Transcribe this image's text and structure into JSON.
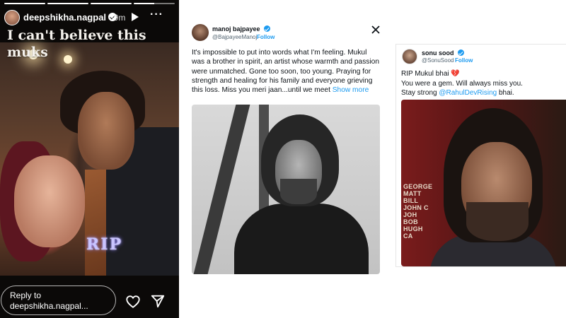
{
  "story": {
    "username": "deepshikha.nagpal",
    "time": "39m",
    "caption_line1": "I can't believe this",
    "caption_line2": "muks",
    "sticker": "RIP",
    "reply_prefix": "Reply to",
    "reply_user": "deepshikha.nagpal...",
    "progress": [
      1,
      1,
      1,
      0.5
    ]
  },
  "tweet1": {
    "name": "manoj bajpayee",
    "handle": "@BajpayeeManoj",
    "separator": " · ",
    "follow": "Follow",
    "text": "It's impossible to put into words what I'm feeling. Mukul was a brother in spirit, an artist whose warmth and passion were unmatched. Gone too soon, too young. Praying for strength and healing for his family and everyone grieving this loss. Miss you meri jaan...until we meet ",
    "show_more": "Show more"
  },
  "tweet2": {
    "name": "sonu sood",
    "handle": "@SonuSood",
    "separator": " · ",
    "follow": "Follow",
    "line1": "RIP Mukul bhai ",
    "broken_heart": "💔",
    "line2": "You were a gem. Will always miss you.",
    "line3_prefix": "Stay strong ",
    "mention": "@RahulDevRising",
    "line3_suffix": " bhai.",
    "wall_text": [
      "GEORGE",
      "MATT",
      "BILL",
      "JOHN C",
      "JOH",
      "BOB",
      "HUGH",
      "CA"
    ]
  },
  "colors": {
    "link": "#1d9bf0",
    "verified": "#1d9bf0",
    "story_bg": "#0b0908"
  }
}
